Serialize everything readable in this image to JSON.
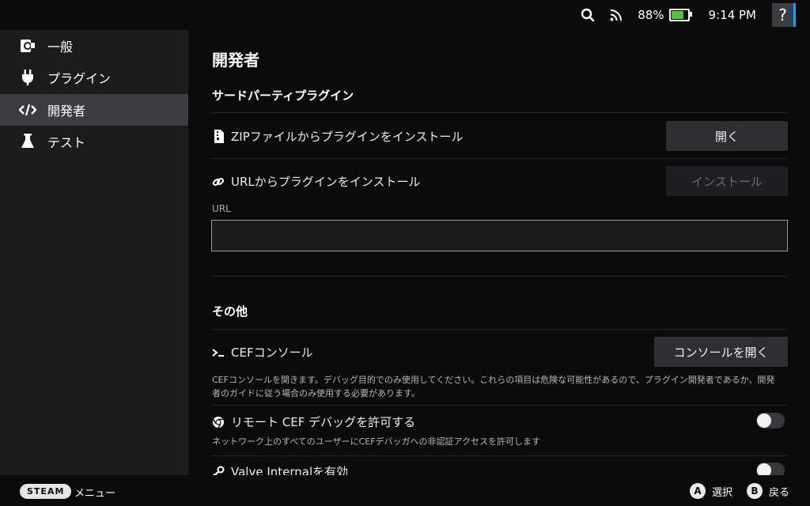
{
  "status": {
    "battery_pct": "88%",
    "battery_level": 0.88,
    "clock": "9:14 PM",
    "help": "?",
    "icons": [
      "search-icon",
      "rss-icon",
      "battery-icon"
    ],
    "battery_color": "#59bf40",
    "accent_color": "#1a9fff"
  },
  "sidebar": {
    "items": [
      {
        "label": "一般",
        "icon": "general-icon"
      },
      {
        "label": "プラグイン",
        "icon": "plug-icon"
      },
      {
        "label": "開発者",
        "icon": "code-icon",
        "active": true
      },
      {
        "label": "テスト",
        "icon": "flask-icon"
      }
    ]
  },
  "main": {
    "title": "開発者",
    "third_party": {
      "section_title": "サードパーティプラグイン",
      "zip_label": "ZIPファイルからプラグインをインストール",
      "zip_button": "開く",
      "url_label": "URLからプラグインをインストール",
      "url_button": "インストール",
      "url_field_label": "URL",
      "url_value": ""
    },
    "other": {
      "section_title": "その他",
      "cef_console_label": "CEFコンソール",
      "cef_console_button": "コンソールを開く",
      "cef_console_desc": "CEFコンソールを開きます。デバッグ目的でのみ使用してください。これらの項目は危険な可能性があるので、プラグイン開発者であるか、開発者のガイドに従う場合のみ使用する必要があります。",
      "remote_debug_label": "リモート CEF デバッグを許可する",
      "remote_debug_desc": "ネットワーク上のすべてのユーザーにCEFデバッガへの非認証アクセスを許可します",
      "remote_debug_enabled": false,
      "valve_internal_label": "Valve Internalを有効",
      "valve_internal_enabled": false
    }
  },
  "bottom": {
    "steam": "STEAM",
    "menu": "メニュー",
    "select_key": "A",
    "select": "選択",
    "back_key": "B",
    "back": "戻る"
  }
}
